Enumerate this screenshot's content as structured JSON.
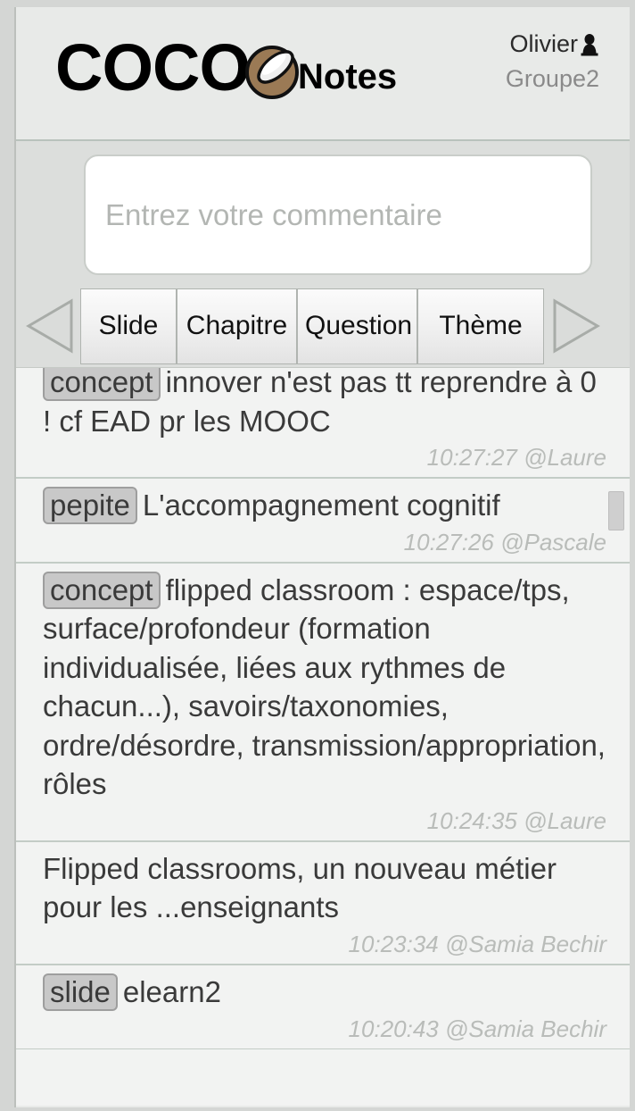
{
  "app": {
    "logo_text_1": "COCO",
    "logo_text_2": "Notes",
    "nut_icon": "coconut-icon"
  },
  "user": {
    "name": "Olivier",
    "icon": "person-icon",
    "group": "Groupe2"
  },
  "composer": {
    "placeholder": "Entrez votre commentaire",
    "value": "",
    "prev_icon": "triangle-left-icon",
    "next_icon": "triangle-right-icon",
    "tabs": [
      {
        "label": "Slide"
      },
      {
        "label": "Chapitre"
      },
      {
        "label": "Question"
      },
      {
        "label": "Thème"
      }
    ]
  },
  "notes": [
    {
      "tag": "concept",
      "text": "innover n'est pas tt reprendre à 0 ! cf EAD pr les MOOC",
      "time": "10:27:27",
      "author": "@Laure",
      "meta": "10:27:27 @Laure"
    },
    {
      "tag": "pepite",
      "text": "L'accompagnement cognitif",
      "time": "10:27:26",
      "author": "@Pascale",
      "meta": "10:27:26 @Pascale"
    },
    {
      "tag": "concept",
      "text": "flipped classroom : espace/tps, surface/profondeur (formation individualisée, liées aux rythmes de chacun...), savoirs/taxonomies, ordre/désordre, transmission/appropriation, rôles",
      "time": "10:24:35",
      "author": "@Laure",
      "meta": "10:24:35 @Laure"
    },
    {
      "tag": "",
      "text": "Flipped classrooms, un nouveau métier pour les ...enseignants",
      "time": "10:23:34",
      "author": "@Samia Bechir",
      "meta": "10:23:34 @Samia Bechir"
    },
    {
      "tag": "slide",
      "text": "elearn2",
      "time": "10:20:43",
      "author": "@Samia Bechir",
      "meta": "10:20:43 @Samia Bechir"
    }
  ],
  "colors": {
    "page_background": "#d4d6d4",
    "header_background": "#e8eae8",
    "composer_background": "#dcdedc",
    "notes_background": "#f2f3f2",
    "tag_background": "#c8c8c8",
    "coconut_shell": "#9b7a55",
    "coconut_flesh": "#e9e9e9",
    "meta_text": "#b9bcb9"
  }
}
